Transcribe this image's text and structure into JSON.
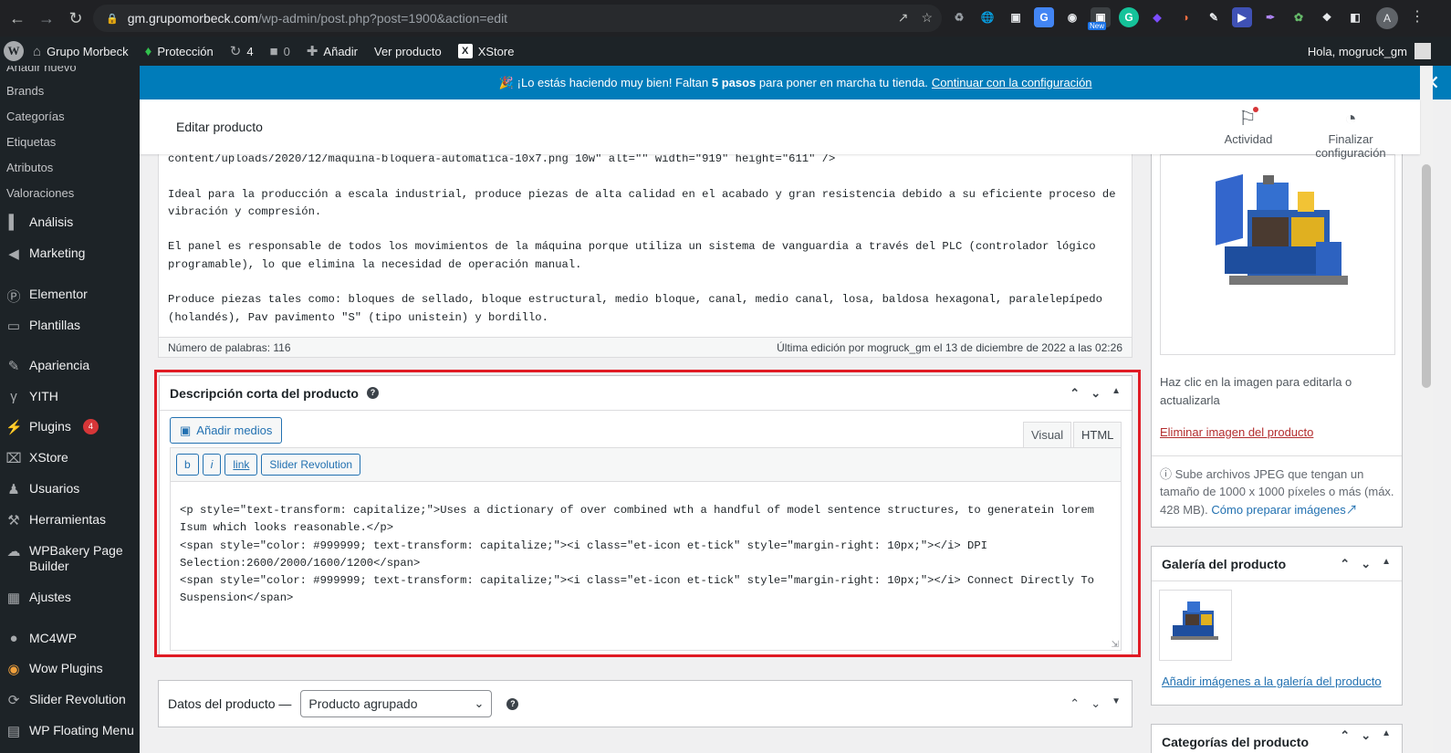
{
  "browser": {
    "url_host": "gm.grupomorbeck.com",
    "url_path": "/wp-admin/post.php?post=1900&action=edit",
    "profile_initial": "A",
    "new_badge": "New"
  },
  "adminbar": {
    "site_name": "Grupo Morbeck",
    "protection": "Protección",
    "updates_count": "4",
    "comments_count": "0",
    "add_new": "Añadir",
    "view_product": "Ver producto",
    "xstore": "XStore",
    "howdy": "Hola, mogruck_gm"
  },
  "sidebar": {
    "sub_items": [
      "Añadir nuevo",
      "Brands",
      "Categorías",
      "Etiquetas",
      "Atributos",
      "Valoraciones"
    ],
    "menu": [
      {
        "label": "Análisis",
        "icon": "chart-bar-icon"
      },
      {
        "label": "Marketing",
        "icon": "megaphone-icon"
      },
      {
        "label": "Elementor",
        "icon": "elementor-icon"
      },
      {
        "label": "Plantillas",
        "icon": "folder-icon"
      },
      {
        "label": "Apariencia",
        "icon": "brush-icon"
      },
      {
        "label": "YITH",
        "icon": "yith-icon"
      },
      {
        "label": "Plugins",
        "icon": "plugin-icon",
        "badge": "4"
      },
      {
        "label": "XStore",
        "icon": "xstore-icon"
      },
      {
        "label": "Usuarios",
        "icon": "users-icon"
      },
      {
        "label": "Herramientas",
        "icon": "wrench-icon"
      },
      {
        "label": "WPBakery Page Builder",
        "icon": "wpbakery-icon"
      },
      {
        "label": "Ajustes",
        "icon": "settings-icon"
      },
      {
        "label": "MC4WP",
        "icon": "mc4wp-icon"
      },
      {
        "label": "Wow Plugins",
        "icon": "wow-icon"
      },
      {
        "label": "Slider Revolution",
        "icon": "slider-icon"
      },
      {
        "label": "WP Floating Menu",
        "icon": "floating-menu-icon"
      }
    ]
  },
  "notice": {
    "emoji": "🎉",
    "text_before": "¡Lo estás haciendo muy bien! Faltan",
    "bold": "5 pasos",
    "text_after": "para poner en marcha tu tienda.",
    "link": "Continuar con la configuración"
  },
  "header": {
    "title": "Editar producto",
    "activity": "Actividad",
    "finish_setup": "Finalizar configuración"
  },
  "editor": {
    "lines": [
      "content/uploads/2020/12/maquina-bloquera-automatica-10x7.png 10w\" alt=\"\" width=\"919\" height=\"611\" />",
      "",
      "Ideal para la producción a escala industrial, produce piezas de alta calidad en el acabado y gran resistencia debido a su eficiente proceso de vibración y compresión.",
      "",
      "El panel es responsable de todos los movimientos de la máquina porque utiliza un sistema de vanguardia a través del PLC (controlador lógico programable), lo que elimina la necesidad de operación manual.",
      "",
      "Produce piezas tales como: bloques de sellado, bloque estructural, medio bloque, canal, medio canal, losa, baldosa hexagonal, paralelepípedo (holandés), Pav pavimento \"S\" (tipo unistein) y bordillo."
    ],
    "word_count": "Número de palabras: 116",
    "last_edit": "Última edición por mogruck_gm el 13 de diciembre de 2022 a las 02:26"
  },
  "short_description": {
    "title": "Descripción corta del producto",
    "add_media": "Añadir medios",
    "tab_visual": "Visual",
    "tab_html": "HTML",
    "quicktags": [
      "b",
      "i",
      "link",
      "Slider Revolution"
    ],
    "code": "<p style=\"text-transform: capitalize;\">Uses a dictionary of over combined wth a handful of model sentence structures, to generatein lorem Isum which looks reasonable.</p>\n<span style=\"color: #999999; text-transform: capitalize;\"><i class=\"et-icon et-tick\" style=\"margin-right: 10px;\"></i> DPI Selection:2600/2000/1600/1200</span>\n<span style=\"color: #999999; text-transform: capitalize;\"><i class=\"et-icon et-tick\" style=\"margin-right: 10px;\"></i> Connect Directly To Suspension</span>"
  },
  "product_data": {
    "label": "Datos del producto —",
    "type_selected": "Producto agrupado"
  },
  "product_image": {
    "hint": "Haz clic en la imagen para editarla o actualizarla",
    "remove": "Eliminar imagen del producto",
    "upload_info": "Sube archivos JPEG que tengan un tamaño de 1000 x 1000 píxeles o más (máx. 428 MB).",
    "upload_link": "Cómo preparar imágenes"
  },
  "gallery": {
    "title": "Galería del producto",
    "add_link": "Añadir imágenes a la galería del producto"
  },
  "categories": {
    "title": "Categorías del producto"
  },
  "colors": {
    "admin_dark": "#1d2327",
    "notice_blue": "#007cba",
    "highlight_red": "#e01b24",
    "link_blue": "#2271b1",
    "danger_red": "#b32d2e"
  }
}
